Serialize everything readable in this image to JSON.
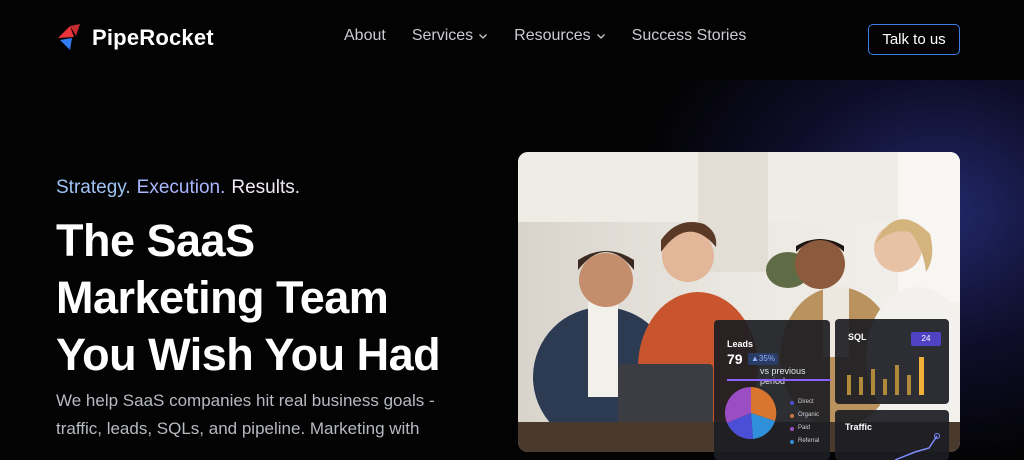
{
  "brand": {
    "name": "PipeRocket",
    "colors": {
      "red": "#e9333a",
      "blue": "#2f7cf6"
    }
  },
  "nav": {
    "items": [
      {
        "label": "About",
        "dropdown": false
      },
      {
        "label": "Services",
        "dropdown": true
      },
      {
        "label": "Resources",
        "dropdown": true
      },
      {
        "label": "Success Stories",
        "dropdown": false
      }
    ],
    "cta_label": "Talk to us"
  },
  "hero": {
    "tagline": [
      "Strategy.",
      "Execution.",
      "Results."
    ],
    "headline": [
      "The SaaS",
      "Marketing Team",
      "You Wish You Had"
    ],
    "subtext_line1": "We help SaaS companies hit real business goals -",
    "subtext_line2": "traffic, leads, SQLs, and pipeline. Marketing with"
  },
  "dashboard": {
    "leads": {
      "title": "Leads",
      "value": "79",
      "change": "▲35%",
      "comparison": "vs previous period",
      "legend": [
        {
          "label": "Direct",
          "color": "#4b4fd6"
        },
        {
          "label": "Organic",
          "color": "#d9752f"
        },
        {
          "label": "Paid",
          "color": "#9a4ec2"
        },
        {
          "label": "Referral",
          "color": "#2f8fd8"
        }
      ]
    },
    "sql": {
      "title": "SQL",
      "value": "24"
    },
    "traffic": {
      "title": "Traffic"
    }
  },
  "icons": {
    "logo": "rocket-logo-icon",
    "dropdown": "chevron-down-icon"
  }
}
